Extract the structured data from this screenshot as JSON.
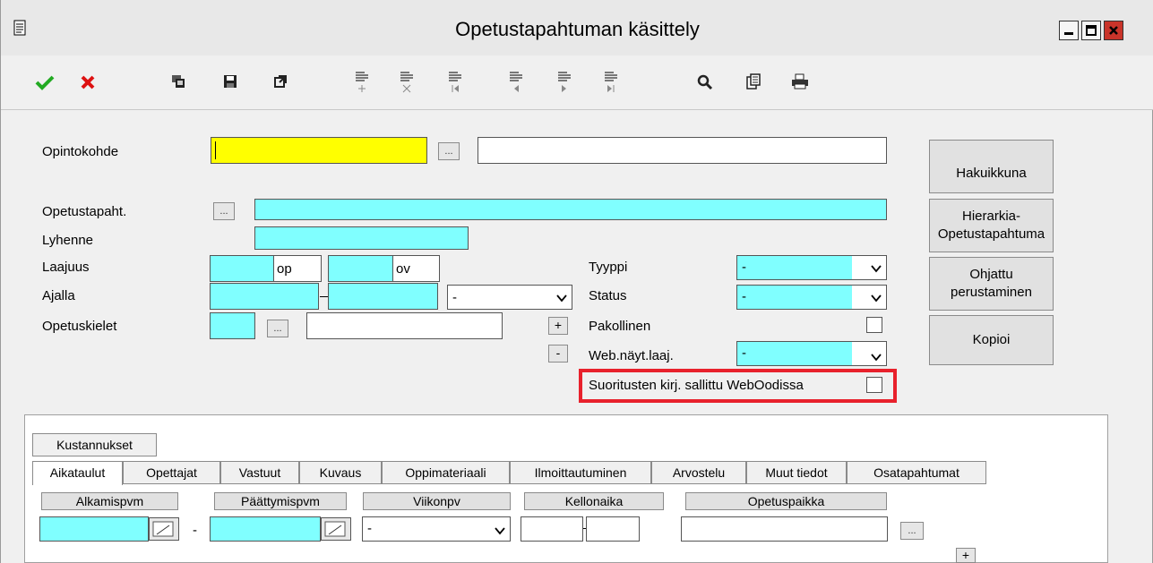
{
  "window": {
    "title": "Opetustapahtuman käsittely",
    "controls": [
      "minimize-icon",
      "maximize-icon",
      "close-icon"
    ]
  },
  "toolbar": {
    "icons": [
      "checkmark-icon",
      "cross-icon",
      "copy-icon",
      "save-icon",
      "export-icon",
      "record-add-icon",
      "record-delete-icon",
      "record-first-icon",
      "record-prev-icon",
      "record-next-icon",
      "record-last-icon",
      "search-icon",
      "document-icon",
      "print-icon"
    ]
  },
  "form": {
    "opintokohde_label": "Opintokohde",
    "opintokohde_value": "",
    "opintokohde_name": "",
    "opetustapaht_label": "Opetustapaht.",
    "opetustapaht_value": "",
    "lyhenne_label": "Lyhenne",
    "lyhenne_value": "",
    "laajuus_label": "Laajuus",
    "laajuus_op_unit": "op",
    "laajuus_ov_unit": "ov",
    "ajalla_label": "Ajalla",
    "ajalla_select": "-",
    "opetuskielet_label": "Opetuskielet",
    "lookup_label": "...",
    "plus_label": "+",
    "minus_label": "-",
    "tyyppi_label": "Tyyppi",
    "tyyppi_value": "-",
    "status_label": "Status",
    "status_value": "-",
    "pakollinen_label": "Pakollinen",
    "web_nayt_label": "Web.näyt.laaj.",
    "web_nayt_value": "-",
    "suoritusten_label": "Suoritusten kirj. sallittu WebOodissa"
  },
  "side_buttons": {
    "hakuikkuna": "Hakuikkuna",
    "hierarkia_line1": "Hierarkia-",
    "hierarkia_line2": "Opetustapahtuma",
    "ohjattu_line1": "Ohjattu",
    "ohjattu_line2": "perustaminen",
    "kopioi": "Kopioi"
  },
  "tabs_row1": [
    "Kustannukset"
  ],
  "tabs_row2": [
    "Aikataulut",
    "Opettajat",
    "Vastuut",
    "Kuvaus",
    "Oppimateriaali",
    "Ilmoittautuminen",
    "Arvostelu",
    "Muut tiedot",
    "Osatapahtumat"
  ],
  "schedule": {
    "headers": [
      "Alkamispvm",
      "Päättymispvm",
      "Viikonpv",
      "Kellonaika",
      "Opetuspaikka"
    ],
    "dash": "-",
    "viikonpv_value": "-",
    "lookup_label": "...",
    "plus_label": "+"
  },
  "colors": {
    "required_field": "#80ffff",
    "focus_field": "#ffff00",
    "highlight_border": "#e8212c"
  }
}
